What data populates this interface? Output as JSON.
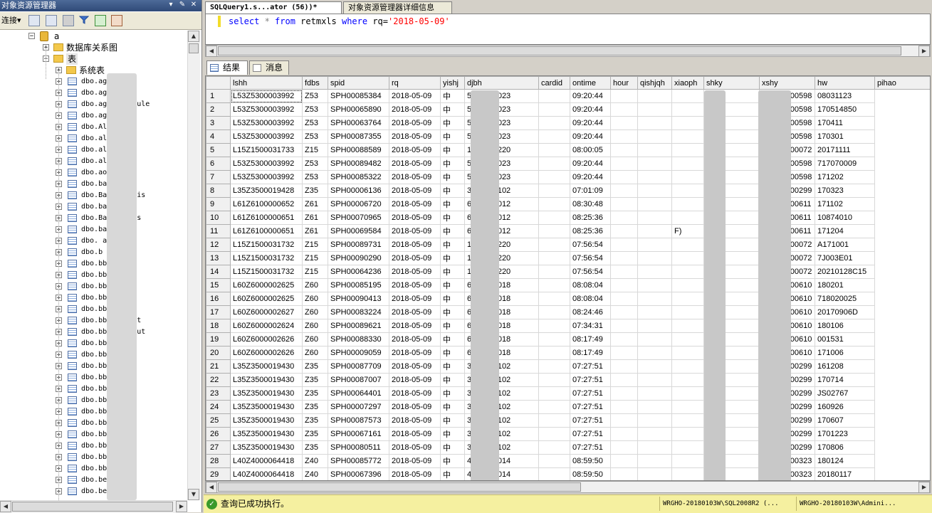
{
  "explorer": {
    "title": "对象资源管理器",
    "pin_glyph": "▾",
    "pushpin_glyph": "✎",
    "close_glyph": "✕",
    "connect_label": "连接",
    "connect_arrow": "▾",
    "db_label": "a",
    "nodes": [
      {
        "label": "数据库关系图",
        "kind": "folder",
        "expand": "+"
      },
      {
        "label": "表",
        "kind": "folder",
        "expand": "−"
      },
      {
        "label": "系统表",
        "kind": "folder",
        "expand": "+"
      }
    ],
    "tables": [
      "dbo.ag_",
      "dbo.ag_   group",
      "dbo.ag_   schedule",
      "dbo.ag_   step",
      "dbo.Al    etup",
      "dbo.all",
      "dbo.all   r",
      "dbo.all   az",
      "dbo.ao    hao",
      "dbo.baoj",
      "dbo.Bac   naz_his",
      "dbo.bao   x",
      "dbo.Bac   nx_his",
      "dbo.ba    hgz",
      "dbo.      admin",
      "dbo.b     bs",
      "dbo.bb    slink",
      "dbo.bb    ard",
      "dbo.bbs   ass",
      "dbo.bbs   fig",
      "dbo.bbs   ter",
      "dbo.bbs   gnlist",
      "dbo.bbs_  layout",
      "dbo.bbs   ktop",
      "dbo.bb    iend",
      "dbo.bbs_  dr",
      "dbo.bbs_",
      "dbo.bbs_",
      "dbo.bbs   ssage",
      "dbo.bbs_  ine",
      "dbo.bbs_  t",
      "dbo.bbs_  n",
      "dbo.bbs_  ji",
      "dbo.bbs_  r",
      "dbo.bbs_",
      "dbo.bei   a",
      "dbo.be"
    ]
  },
  "editor": {
    "tab_query": "SQLQuery1.s...ator (56))*",
    "tab_details": "对象资源管理器详细信息",
    "sql": {
      "kw_select": "select",
      "star": " * ",
      "kw_from": "from",
      "table": " retmxls ",
      "kw_where": "where",
      "col": " rq=",
      "value": "'2018-05-09'"
    },
    "result_tabs": {
      "results": "结果",
      "messages": "消息"
    }
  },
  "grid": {
    "columns": [
      "lshh",
      "fdbs",
      "spid",
      "rq",
      "yishj",
      "djbh",
      "cardid",
      "ontime",
      "hour",
      "qishjqh",
      "xiaoph",
      "shky",
      "xshy",
      "hw",
      "pihao"
    ],
    "rows": [
      [
        "1",
        "L53Z5300003992",
        "Z53",
        "SPH00085384",
        "2018-05-09",
        "中",
        "5300000023",
        "",
        "09:20:44",
        "",
        "",
        "",
        "",
        "HWI00000598",
        "08031123"
      ],
      [
        "2",
        "L53Z5300003992",
        "Z53",
        "SPH00065890",
        "2018-05-09",
        "中",
        "5300000023",
        "",
        "09:20:44",
        "",
        "",
        "",
        "",
        "HWI00000598",
        "170514850"
      ],
      [
        "3",
        "L53Z5300003992",
        "Z53",
        "SPH00063764",
        "2018-05-09",
        "中",
        "5300000023",
        "",
        "09:20:44",
        "",
        "",
        "",
        "",
        "HWI00000598",
        "170411"
      ],
      [
        "4",
        "L53Z5300003992",
        "Z53",
        "SPH00087355",
        "2018-05-09",
        "中",
        "5300000023",
        "",
        "09:20:44",
        "",
        "",
        "",
        "",
        "HWI00000598",
        "170301"
      ],
      [
        "5",
        "L15Z1500031733",
        "Z15",
        "SPH00088589",
        "2018-05-09",
        "中",
        "1500000220",
        "",
        "08:00:05",
        "",
        "",
        "",
        "",
        "HWI00000072",
        "20171111"
      ],
      [
        "6",
        "L53Z5300003992",
        "Z53",
        "SPH00089482",
        "2018-05-09",
        "中",
        "5300000023",
        "",
        "09:20:44",
        "",
        "",
        "",
        "",
        "HWI00000598",
        "717070009"
      ],
      [
        "7",
        "L53Z5300003992",
        "Z53",
        "SPH00085322",
        "2018-05-09",
        "中",
        "5300000023",
        "",
        "09:20:44",
        "",
        "",
        "",
        "",
        "HWI00000598",
        "171202"
      ],
      [
        "8",
        "L35Z3500019428",
        "Z35",
        "SPH00006136",
        "2018-05-09",
        "中",
        "3500000102",
        "",
        "07:01:09",
        "",
        "",
        "",
        "",
        "HWI00000299",
        "170323"
      ],
      [
        "9",
        "L61Z6100000652",
        "Z61",
        "SPH00006720",
        "2018-05-09",
        "中",
        "6100000012",
        "",
        "08:30:48",
        "",
        "",
        "",
        "BLF)",
        "HWI00000611",
        "171102"
      ],
      [
        "10",
        "L61Z6100000651",
        "Z61",
        "SPH00070965",
        "2018-05-09",
        "中",
        "6100000012",
        "",
        "08:25:36",
        "",
        "",
        "",
        "BLF)",
        "HWI00000611",
        "10874010"
      ],
      [
        "11",
        "L61Z6100000651",
        "Z61",
        "SPH00069584",
        "2018-05-09",
        "中",
        "6100000012",
        "",
        "08:25:36",
        "",
        "",
        "F)",
        "BLF)",
        "HWI00000611",
        "171204"
      ],
      [
        "12",
        "L15Z1500031732",
        "Z15",
        "SPH00089731",
        "2018-05-09",
        "中",
        "1500000220",
        "",
        "07:56:54",
        "",
        "",
        "",
        "",
        "HWI00000072",
        "A171001"
      ],
      [
        "13",
        "L15Z1500031732",
        "Z15",
        "SPH00090290",
        "2018-05-09",
        "中",
        "1500000220",
        "",
        "07:56:54",
        "",
        "",
        "",
        "",
        "HWI00000072",
        "7J003E01"
      ],
      [
        "14",
        "L15Z1500031732",
        "Z15",
        "SPH00064236",
        "2018-05-09",
        "中",
        "1500000220",
        "",
        "07:56:54",
        "",
        "",
        "",
        "",
        "HWI00000072",
        "20210128C15"
      ],
      [
        "15",
        "L60Z6000002625",
        "Z60",
        "SPH00085195",
        "2018-05-09",
        "中",
        "6000000018",
        "",
        "08:08:04",
        "",
        "",
        "",
        "",
        "HWI00000610",
        "180201"
      ],
      [
        "16",
        "L60Z6000002625",
        "Z60",
        "SPH00090413",
        "2018-05-09",
        "中",
        "6000000018",
        "",
        "08:08:04",
        "",
        "",
        "",
        "",
        "HWI00000610",
        "718020025"
      ],
      [
        "17",
        "L60Z6000002627",
        "Z60",
        "SPH00083224",
        "2018-05-09",
        "中",
        "6000000018",
        "",
        "08:24:46",
        "",
        "",
        "",
        "",
        "HWI00000610",
        "20170906D"
      ],
      [
        "18",
        "L60Z6000002624",
        "Z60",
        "SPH00089621",
        "2018-05-09",
        "中",
        "6000000018",
        "",
        "07:34:31",
        "",
        "",
        "",
        "",
        "HWI00000610",
        "180106"
      ],
      [
        "19",
        "L60Z6000002626",
        "Z60",
        "SPH00088330",
        "2018-05-09",
        "中",
        "6000000018",
        "",
        "08:17:49",
        "",
        "",
        "",
        "",
        "HWI00000610",
        "001531"
      ],
      [
        "20",
        "L60Z6000002626",
        "Z60",
        "SPH00009059",
        "2018-05-09",
        "中",
        "6000000018",
        "",
        "08:17:49",
        "",
        "",
        "",
        "",
        "HWI00000610",
        "171006"
      ],
      [
        "21",
        "L35Z3500019430",
        "Z35",
        "SPH00087709",
        "2018-05-09",
        "中",
        "3500000102",
        "",
        "07:27:51",
        "",
        "",
        "",
        "",
        "HWI00000299",
        "161208"
      ],
      [
        "22",
        "L35Z3500019430",
        "Z35",
        "SPH00087007",
        "2018-05-09",
        "中",
        "3500000102",
        "",
        "07:27:51",
        "",
        "",
        "",
        "",
        "HWI00000299",
        "170714"
      ],
      [
        "23",
        "L35Z3500019430",
        "Z35",
        "SPH00064401",
        "2018-05-09",
        "中",
        "3500000102",
        "",
        "07:27:51",
        "",
        "",
        "",
        "",
        "HWI00000299",
        "JS02767"
      ],
      [
        "24",
        "L35Z3500019430",
        "Z35",
        "SPH00007297",
        "2018-05-09",
        "中",
        "3500000102",
        "",
        "07:27:51",
        "",
        "",
        "",
        "",
        "HWI00000299",
        "160926"
      ],
      [
        "25",
        "L35Z3500019430",
        "Z35",
        "SPH00087573",
        "2018-05-09",
        "中",
        "3500000102",
        "",
        "07:27:51",
        "",
        "",
        "",
        "",
        "HWI00000299",
        "170607"
      ],
      [
        "26",
        "L35Z3500019430",
        "Z35",
        "SPH00067161",
        "2018-05-09",
        "中",
        "3500000102",
        "",
        "07:27:51",
        "",
        "",
        "",
        "",
        "HWI00000299",
        "1701223"
      ],
      [
        "27",
        "L35Z3500019430",
        "Z35",
        "SPH00080511",
        "2018-05-09",
        "中",
        "3500000102",
        "",
        "07:27:51",
        "",
        "",
        "",
        "",
        "HWI00000299",
        "170806"
      ],
      [
        "28",
        "L40Z4000064418",
        "Z40",
        "SPH00085772",
        "2018-05-09",
        "中",
        "4000000014",
        "",
        "08:59:50",
        "",
        "",
        "",
        "",
        "HWI00000323",
        "180124"
      ],
      [
        "29",
        "L40Z4000064418",
        "Z40",
        "SPH00067396",
        "2018-05-09",
        "中",
        "4000000014",
        "",
        "08:59:50",
        "",
        "",
        "",
        "",
        "HWI00000323",
        "20180117"
      ]
    ]
  },
  "status": {
    "ok_glyph": "✓",
    "message": "查询已成功执行。",
    "server": "WRGHO-20180103W\\SQL2008R2 (...",
    "user": "WRGHO-20180103W\\Admini..."
  },
  "scroll_glyphs": {
    "up": "▲",
    "down": "▼",
    "left": "◀",
    "right": "▶"
  }
}
